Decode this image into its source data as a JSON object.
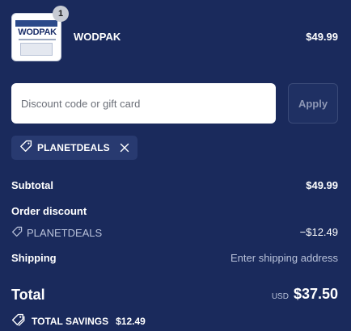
{
  "product": {
    "name": "WODPAK",
    "price": "$49.99",
    "quantity": "1",
    "thumbnail_brand": "WODPAK"
  },
  "discount": {
    "placeholder": "Discount code or gift card",
    "value": "",
    "apply_label": "Apply",
    "applied_code": "PLANETDEALS"
  },
  "summary": {
    "subtotal_label": "Subtotal",
    "subtotal_value": "$49.99",
    "order_discount_label": "Order discount",
    "discount_code": "PLANETDEALS",
    "discount_value": "−$12.49",
    "shipping_label": "Shipping",
    "shipping_value": "Enter shipping address",
    "total_label": "Total",
    "currency": "USD",
    "total_value": "$37.50",
    "savings_label": "TOTAL SAVINGS",
    "savings_value": "$12.49"
  },
  "icons": {
    "tag": "tag-icon",
    "remove": "close-icon",
    "savings": "savings-tag-icon"
  },
  "colors": {
    "background": "#1a2a5c",
    "chip_background": "#283a70",
    "muted_text": "#b9c2da",
    "text": "#ffffff"
  }
}
